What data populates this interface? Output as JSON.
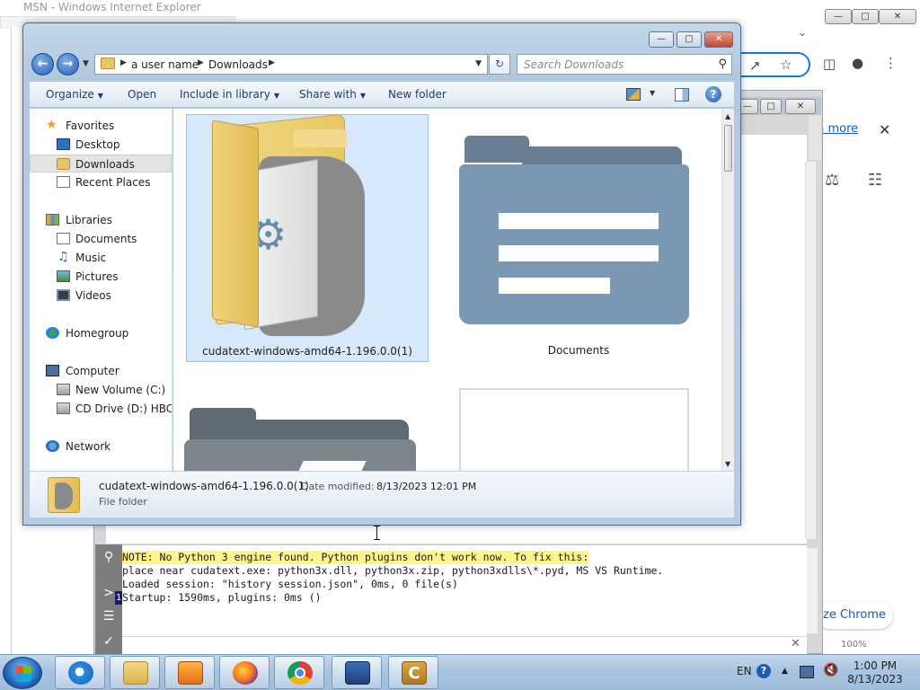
{
  "background_ie": {
    "title": "MSN - Windows Internet Explorer"
  },
  "chrome": {
    "learn_more": "rn more",
    "customize": "ze Chrome",
    "zoom": "100%"
  },
  "cudatext": {
    "console_lines": [
      "NOTE: No Python 3 engine found. Python plugins don't work now. To fix this:",
      "place near cudatext.exe: python3x.dll, python3x.zip, python3xdlls\\*.pyd, MS VS Runtime.",
      "Loaded session: \"history session.json\", 0ms, 0 file(s)",
      "Startup: 1590ms, plugins: 0ms ()"
    ],
    "line_number": "1"
  },
  "explorer": {
    "breadcrumb": [
      "a user name",
      "Downloads"
    ],
    "search_placeholder": "Search Downloads",
    "toolbar": {
      "organize": "Organize",
      "open": "Open",
      "include_in_library": "Include in library",
      "share_with": "Share with",
      "new_folder": "New folder"
    },
    "nav": {
      "favorites": "Favorites",
      "desktop": "Desktop",
      "downloads": "Downloads",
      "recent_places": "Recent Places",
      "libraries": "Libraries",
      "documents": "Documents",
      "music": "Music",
      "pictures": "Pictures",
      "videos": "Videos",
      "homegroup": "Homegroup",
      "computer": "Computer",
      "new_volume": "New Volume (C:)",
      "cd_drive": "CD Drive (D:) HBCD_",
      "network": "Network"
    },
    "items": [
      {
        "name": "cudatext-windows-amd64-1.196.0.0(1)",
        "selected": true
      },
      {
        "name": "Documents",
        "selected": false
      }
    ],
    "details": {
      "name": "cudatext-windows-amd64-1.196.0.0(1)",
      "modified_label": "Date modified:",
      "modified_value": "8/13/2023 12:01 PM",
      "type": "File folder"
    }
  },
  "taskbar": {
    "language": "EN",
    "time": "1:00 PM",
    "date": "8/13/2023"
  },
  "icons": {
    "start": "windows-start-icon",
    "pinned": [
      "internet-explorer-icon",
      "file-explorer-icon",
      "media-player-icon",
      "firefox-icon",
      "chrome-icon",
      "remote-desktop-icon",
      "cudatext-icon"
    ]
  },
  "colors": {
    "selection": "#d7e8fa",
    "console_note_highlight": "#fdf58a",
    "chrome_accent": "#1a73e8"
  }
}
